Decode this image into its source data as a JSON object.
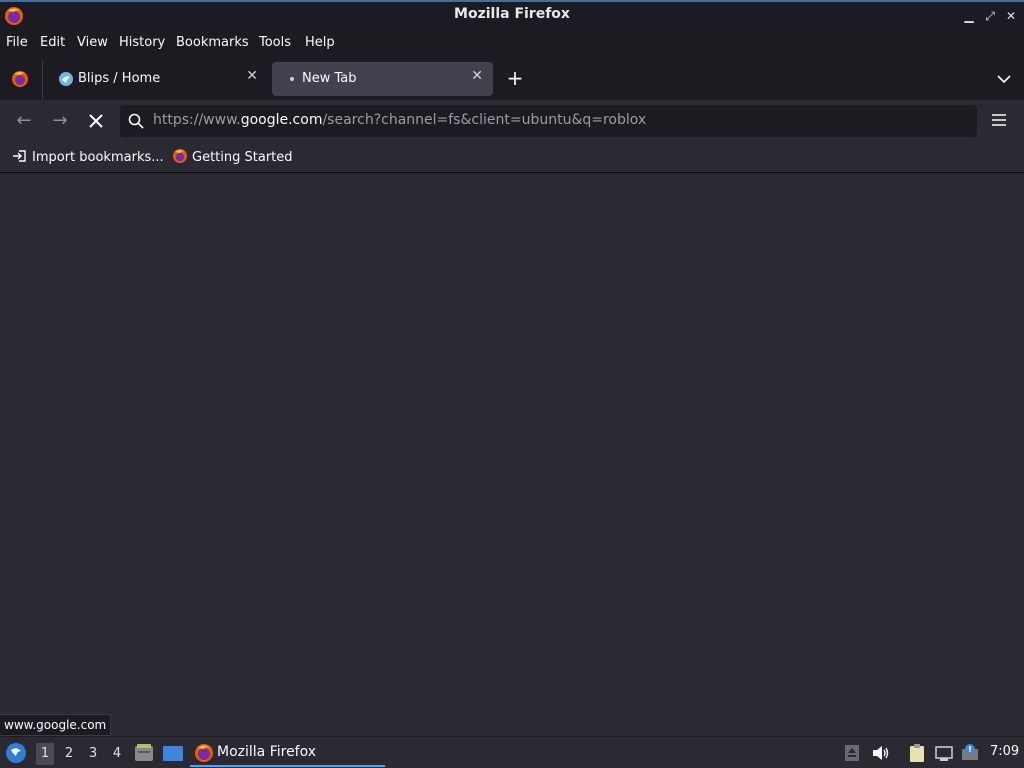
{
  "window": {
    "title": "Mozilla Firefox"
  },
  "menu": {
    "file": "File",
    "edit": "Edit",
    "view": "View",
    "history": "History",
    "bookmarks": "Bookmarks",
    "tools": "Tools",
    "help": "Help"
  },
  "tabs": [
    {
      "label": "Blips / Home",
      "icon": "blips-bird-icon",
      "active": false
    },
    {
      "label": "New Tab",
      "icon": "loading-dot-icon",
      "active": true
    }
  ],
  "urlbar": {
    "prefix": "https://www.",
    "host": "google.com",
    "path": "/search?channel=fs&client=ubuntu&q=roblox"
  },
  "bookmarks_toolbar": {
    "import": "Import bookmarks...",
    "getting_started": "Getting Started"
  },
  "status_tip": "www.google.com",
  "taskbar": {
    "workspaces": [
      "1",
      "2",
      "3",
      "4"
    ],
    "active_workspace": "1",
    "task_label": "Mozilla Firefox",
    "clock": "7:09"
  },
  "colors": {
    "toolbar": "#1c1b22",
    "content": "#2b2a33",
    "active_tab": "#42414d",
    "accent": "#5aa0e6"
  }
}
